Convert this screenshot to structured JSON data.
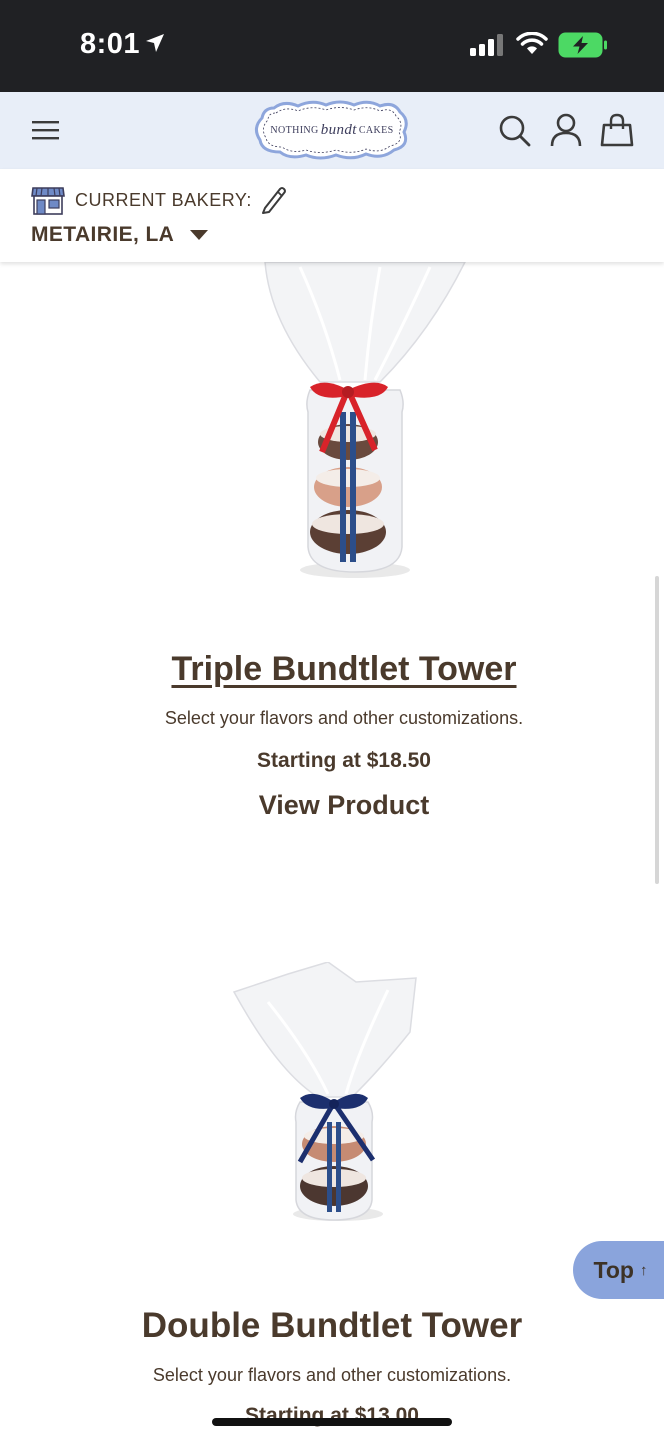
{
  "status_bar": {
    "time": "8:01"
  },
  "header": {
    "logo": {
      "word1": "NOTHING",
      "word2": "bundt",
      "word3": "CAKES"
    }
  },
  "bakery": {
    "label": "CURRENT BAKERY:",
    "location": "METAIRIE, LA"
  },
  "products": [
    {
      "title": "Triple Bundtlet Tower",
      "description": "Select your flavors and other customizations.",
      "price": "Starting at $18.50",
      "cta": "View Product",
      "ribbon_color": "#d8232a"
    },
    {
      "title": "Double Bundtlet Tower",
      "description": "Select your flavors and other customizations.",
      "price": "Starting at $13.00",
      "ribbon_color": "#1c2f6e"
    }
  ],
  "top_button": {
    "label": "Top",
    "arrow": "↑"
  },
  "colors": {
    "status_bar_bg": "#202124",
    "header_bg": "#e8eef8",
    "text_brown": "#4a3a2c",
    "top_button_bg": "#8aa4dc",
    "battery_green": "#4cd964"
  }
}
